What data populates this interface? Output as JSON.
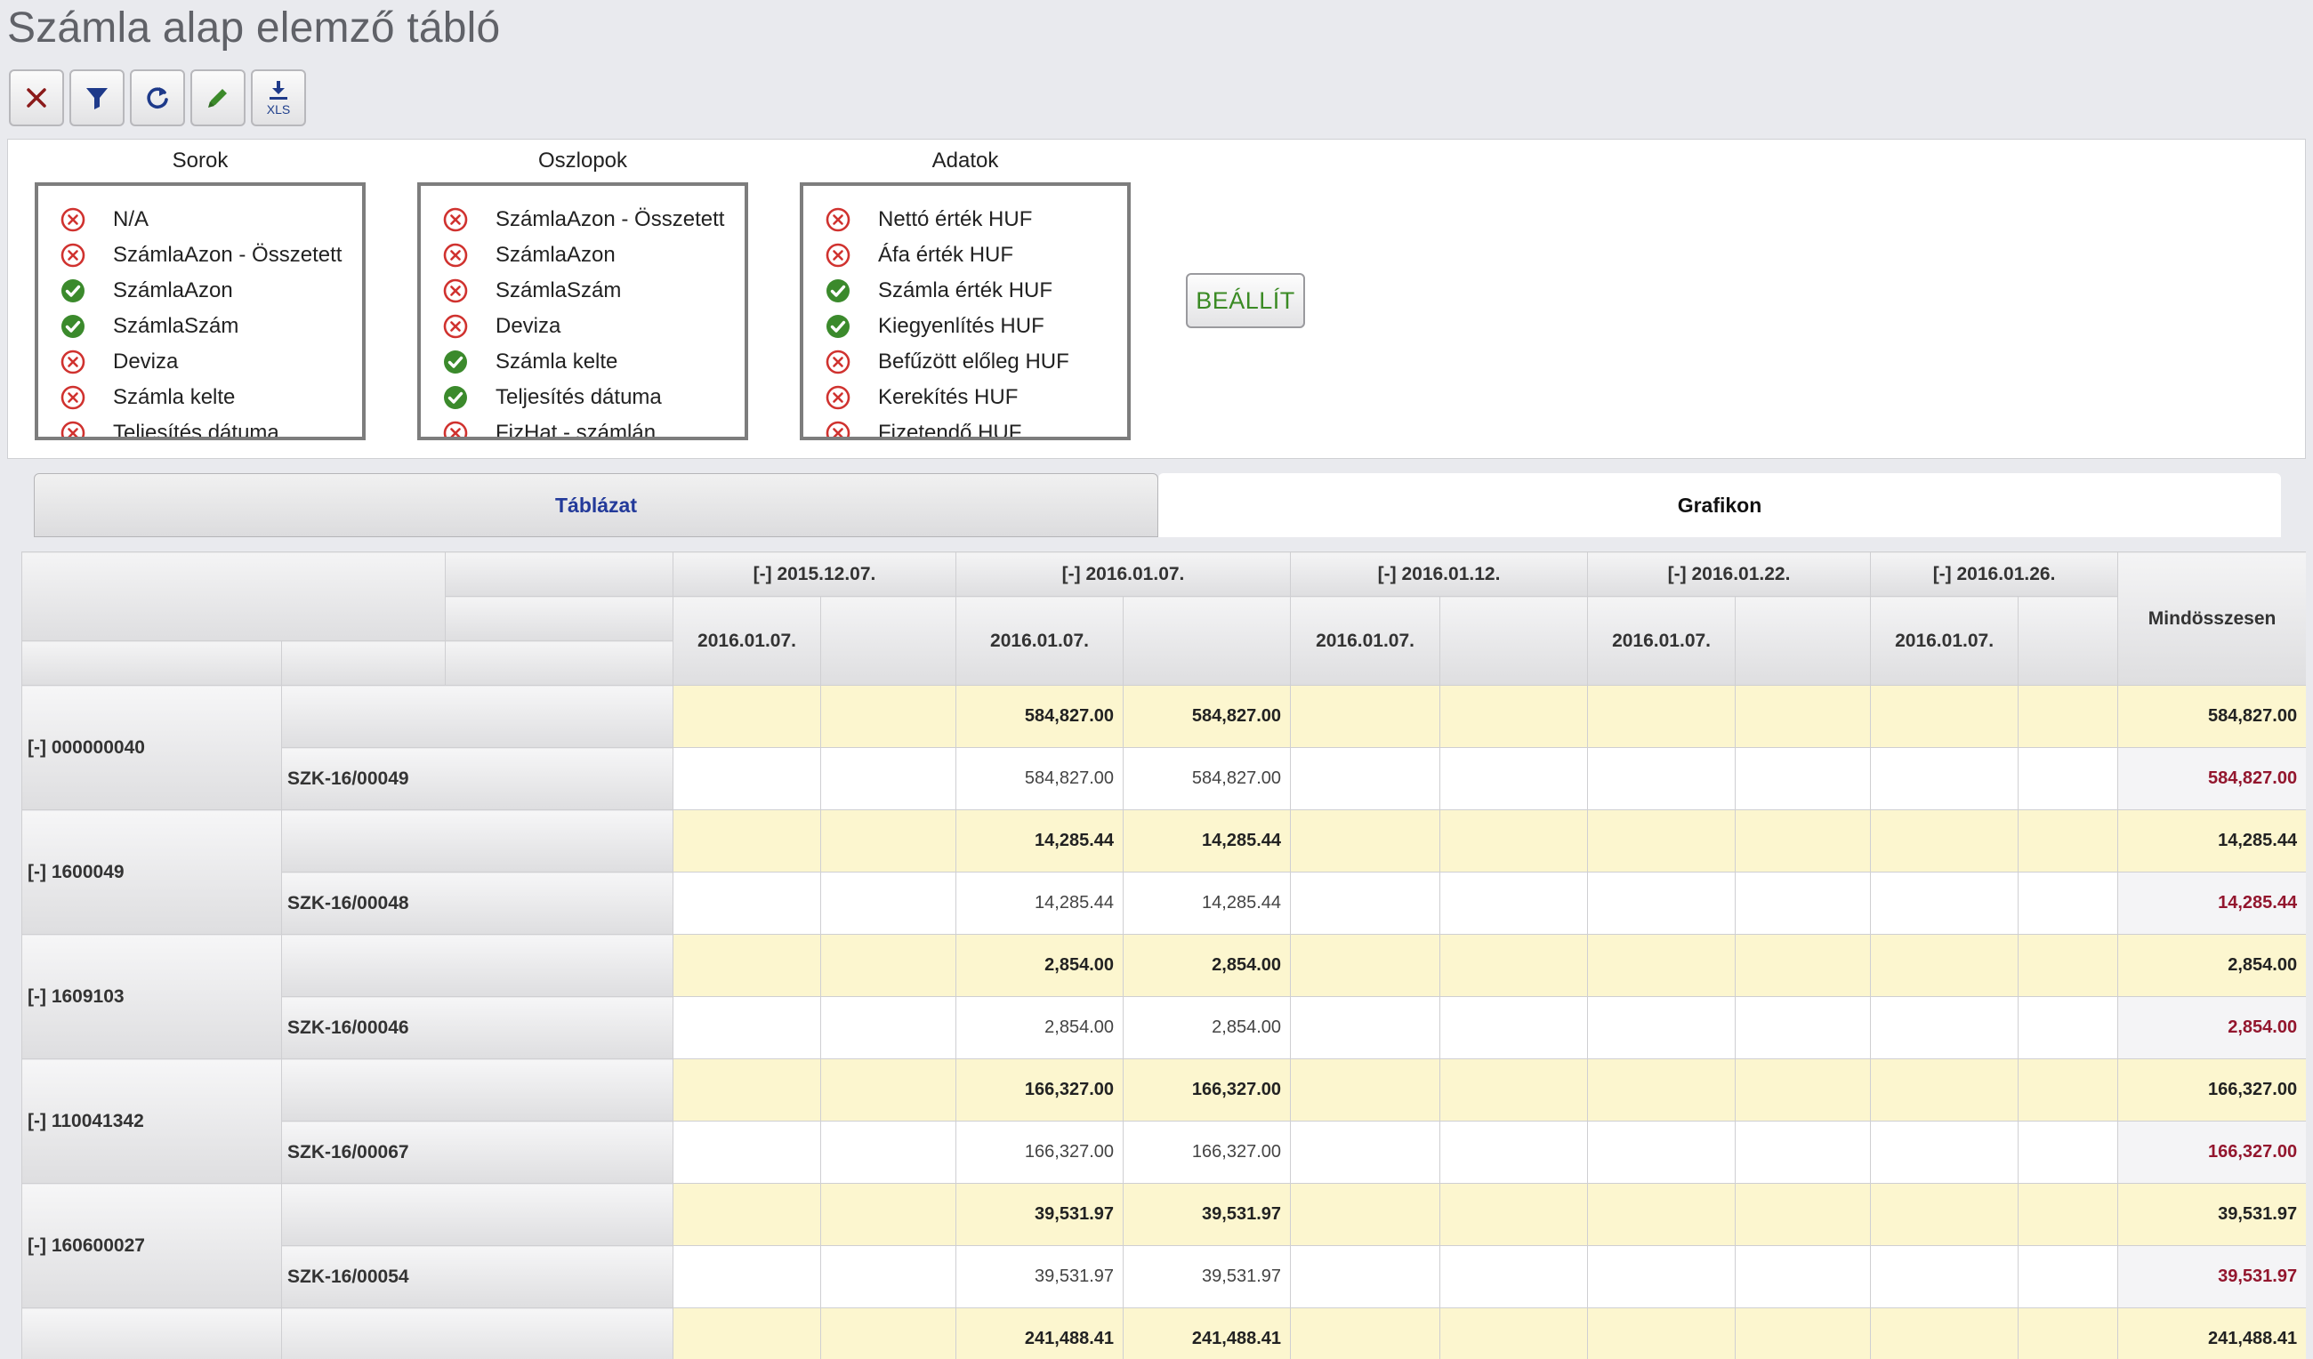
{
  "page": {
    "title": "Számla alap elemző tábló"
  },
  "toolbar": {
    "xls_label": "XLS"
  },
  "sorok": {
    "label": "Sorok",
    "items": [
      {
        "label": "N/A",
        "checked": false
      },
      {
        "label": "SzámlaAzon - Összetett",
        "checked": false
      },
      {
        "label": "SzámlaAzon",
        "checked": true
      },
      {
        "label": "SzámlaSzám",
        "checked": true
      },
      {
        "label": "Deviza",
        "checked": false
      },
      {
        "label": "Számla kelte",
        "checked": false
      },
      {
        "label": "Teljesítés dátuma",
        "checked": false
      }
    ]
  },
  "oszlopok": {
    "label": "Oszlopok",
    "items": [
      {
        "label": "SzámlaAzon - Összetett",
        "checked": false
      },
      {
        "label": "SzámlaAzon",
        "checked": false
      },
      {
        "label": "SzámlaSzám",
        "checked": false
      },
      {
        "label": "Deviza",
        "checked": false
      },
      {
        "label": "Számla kelte",
        "checked": true
      },
      {
        "label": "Teljesítés dátuma",
        "checked": true
      },
      {
        "label": "FizHat - számlán",
        "checked": false
      }
    ]
  },
  "adatok": {
    "label": "Adatok",
    "items": [
      {
        "label": "Nettó érték HUF",
        "checked": false
      },
      {
        "label": "Áfa érték HUF",
        "checked": false
      },
      {
        "label": "Számla érték HUF",
        "checked": true
      },
      {
        "label": "Kiegyenlítés HUF",
        "checked": true
      },
      {
        "label": "Befűzött előleg HUF",
        "checked": false
      },
      {
        "label": "Kerekítés HUF",
        "checked": false
      },
      {
        "label": "Fizetendő HUF",
        "checked": false
      }
    ]
  },
  "set_button": "BEÁLLÍT",
  "tabs": {
    "table": "Táblázat",
    "chart": "Grafikon"
  },
  "grid": {
    "groups": [
      "[-] 2015.12.07.",
      "[-] 2016.01.07.",
      "[-] 2016.01.12.",
      "[-] 2016.01.22.",
      "[-] 2016.01.26."
    ],
    "subdate": "2016.01.07.",
    "total_label": "Mindösszesen",
    "rows": [
      {
        "id": "[-] 000000040",
        "sub": "SZK-16/00049",
        "amount": "584,827.00"
      },
      {
        "id": "[-] 1600049",
        "sub": "SZK-16/00048",
        "amount": "14,285.44"
      },
      {
        "id": "[-] 1609103",
        "sub": "SZK-16/00046",
        "amount": "2,854.00"
      },
      {
        "id": "[-] 110041342",
        "sub": "SZK-16/00067",
        "amount": "166,327.00"
      },
      {
        "id": "[-] 160600027",
        "sub": "SZK-16/00054",
        "amount": "39,531.97"
      }
    ],
    "last_partial_amount": "241,488.41"
  },
  "colors": {
    "ok": "#3b8a2c",
    "no": "#d0322f",
    "total_text": "#93162e",
    "subtotal_bg": "#fcf6cf"
  }
}
